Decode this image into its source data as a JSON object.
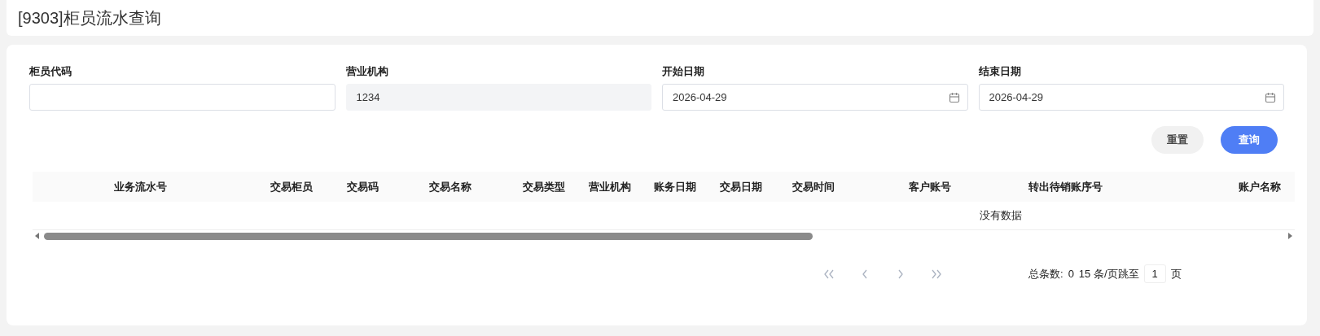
{
  "title": "[9303]柜员流水查询",
  "filters": [
    {
      "label": "柜员代码",
      "kind": "text",
      "disabled": false
    },
    {
      "label": "营业机构",
      "kind": "text",
      "value": "1234",
      "disabled": true
    },
    {
      "label": "开始日期",
      "kind": "date",
      "value": "2026-04-29",
      "disabled": false
    },
    {
      "label": "结束日期",
      "kind": "date",
      "value": "2026-04-29",
      "disabled": false
    }
  ],
  "buttons": [
    {
      "label": "重置",
      "kind": "secondary"
    },
    {
      "label": "查询",
      "kind": "primary"
    }
  ],
  "table": {
    "columns": [
      "业务流水号",
      "交易柜员",
      "交易码",
      "交易名称",
      "交易类型",
      "营业机构",
      "账务日期",
      "交易日期",
      "交易时间",
      "客户账号",
      "转出待销账序号",
      "账户名称"
    ],
    "empty_text": "没有数据"
  },
  "pagination": {
    "total_label": "总条数:",
    "total": "0",
    "page_size": "15 条/页跳至",
    "page": "1",
    "page_suffix": "页"
  }
}
